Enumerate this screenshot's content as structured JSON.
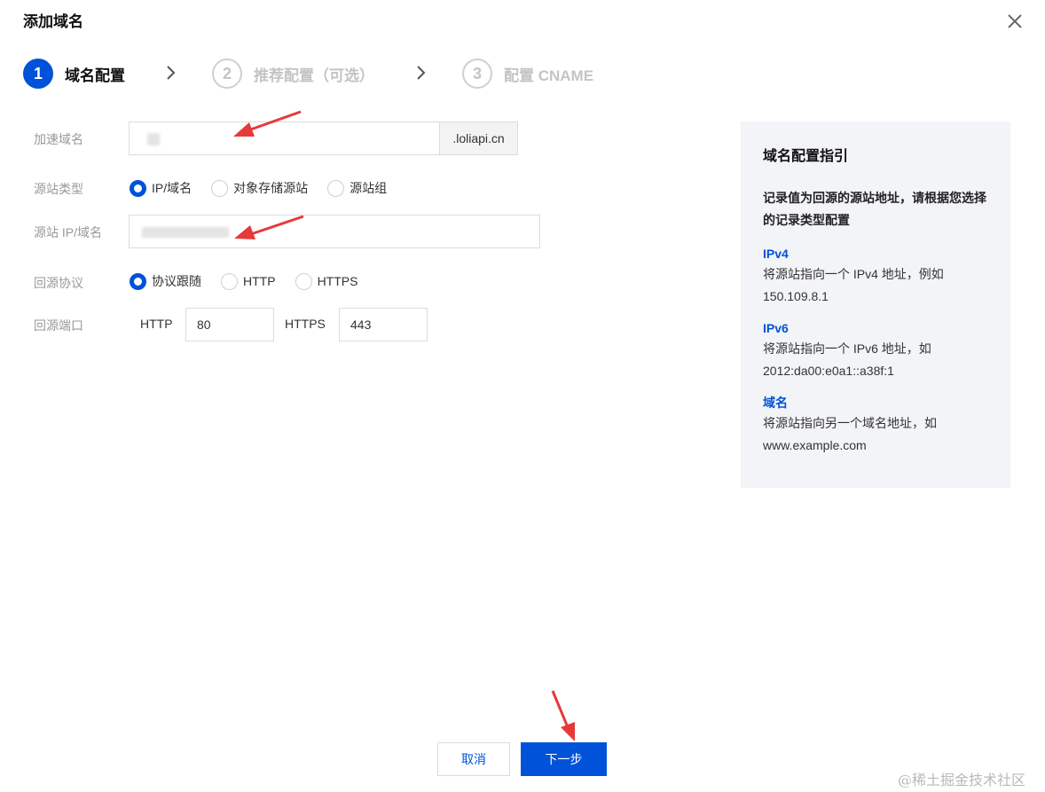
{
  "dialog": {
    "title": "添加域名"
  },
  "steps": [
    {
      "num": "1",
      "label": "域名配置"
    },
    {
      "num": "2",
      "label": "推荐配置（可选）"
    },
    {
      "num": "3",
      "label": "配置 CNAME"
    }
  ],
  "form": {
    "domain_label": "加速域名",
    "domain_suffix": ".loliapi.cn",
    "origin_type_label": "源站类型",
    "origin_type_options": [
      "IP/域名",
      "对象存储源站",
      "源站组"
    ],
    "origin_addr_label": "源站 IP/域名",
    "protocol_label": "回源协议",
    "protocol_options": [
      "协议跟随",
      "HTTP",
      "HTTPS"
    ],
    "port_label": "回源端口",
    "http_label": "HTTP",
    "http_port": "80",
    "https_label": "HTTPS",
    "https_port": "443"
  },
  "guide": {
    "title": "域名配置指引",
    "desc": "记录值为回源的源站地址，请根据您选择的记录类型配置",
    "items": [
      {
        "name": "IPv4",
        "text": "将源站指向一个 IPv4 地址，例如 150.109.8.1"
      },
      {
        "name": "IPv6",
        "text": "将源站指向一个 IPv6 地址，如 2012:da00:e0a1::a38f:1"
      },
      {
        "name": "域名",
        "text": "将源站指向另一个域名地址，如 www.example.com"
      }
    ]
  },
  "footer": {
    "cancel": "取消",
    "next": "下一步"
  },
  "watermark": "@稀土掘金技术社区",
  "colors": {
    "primary": "#0052d9",
    "annotation": "#e8393a"
  }
}
